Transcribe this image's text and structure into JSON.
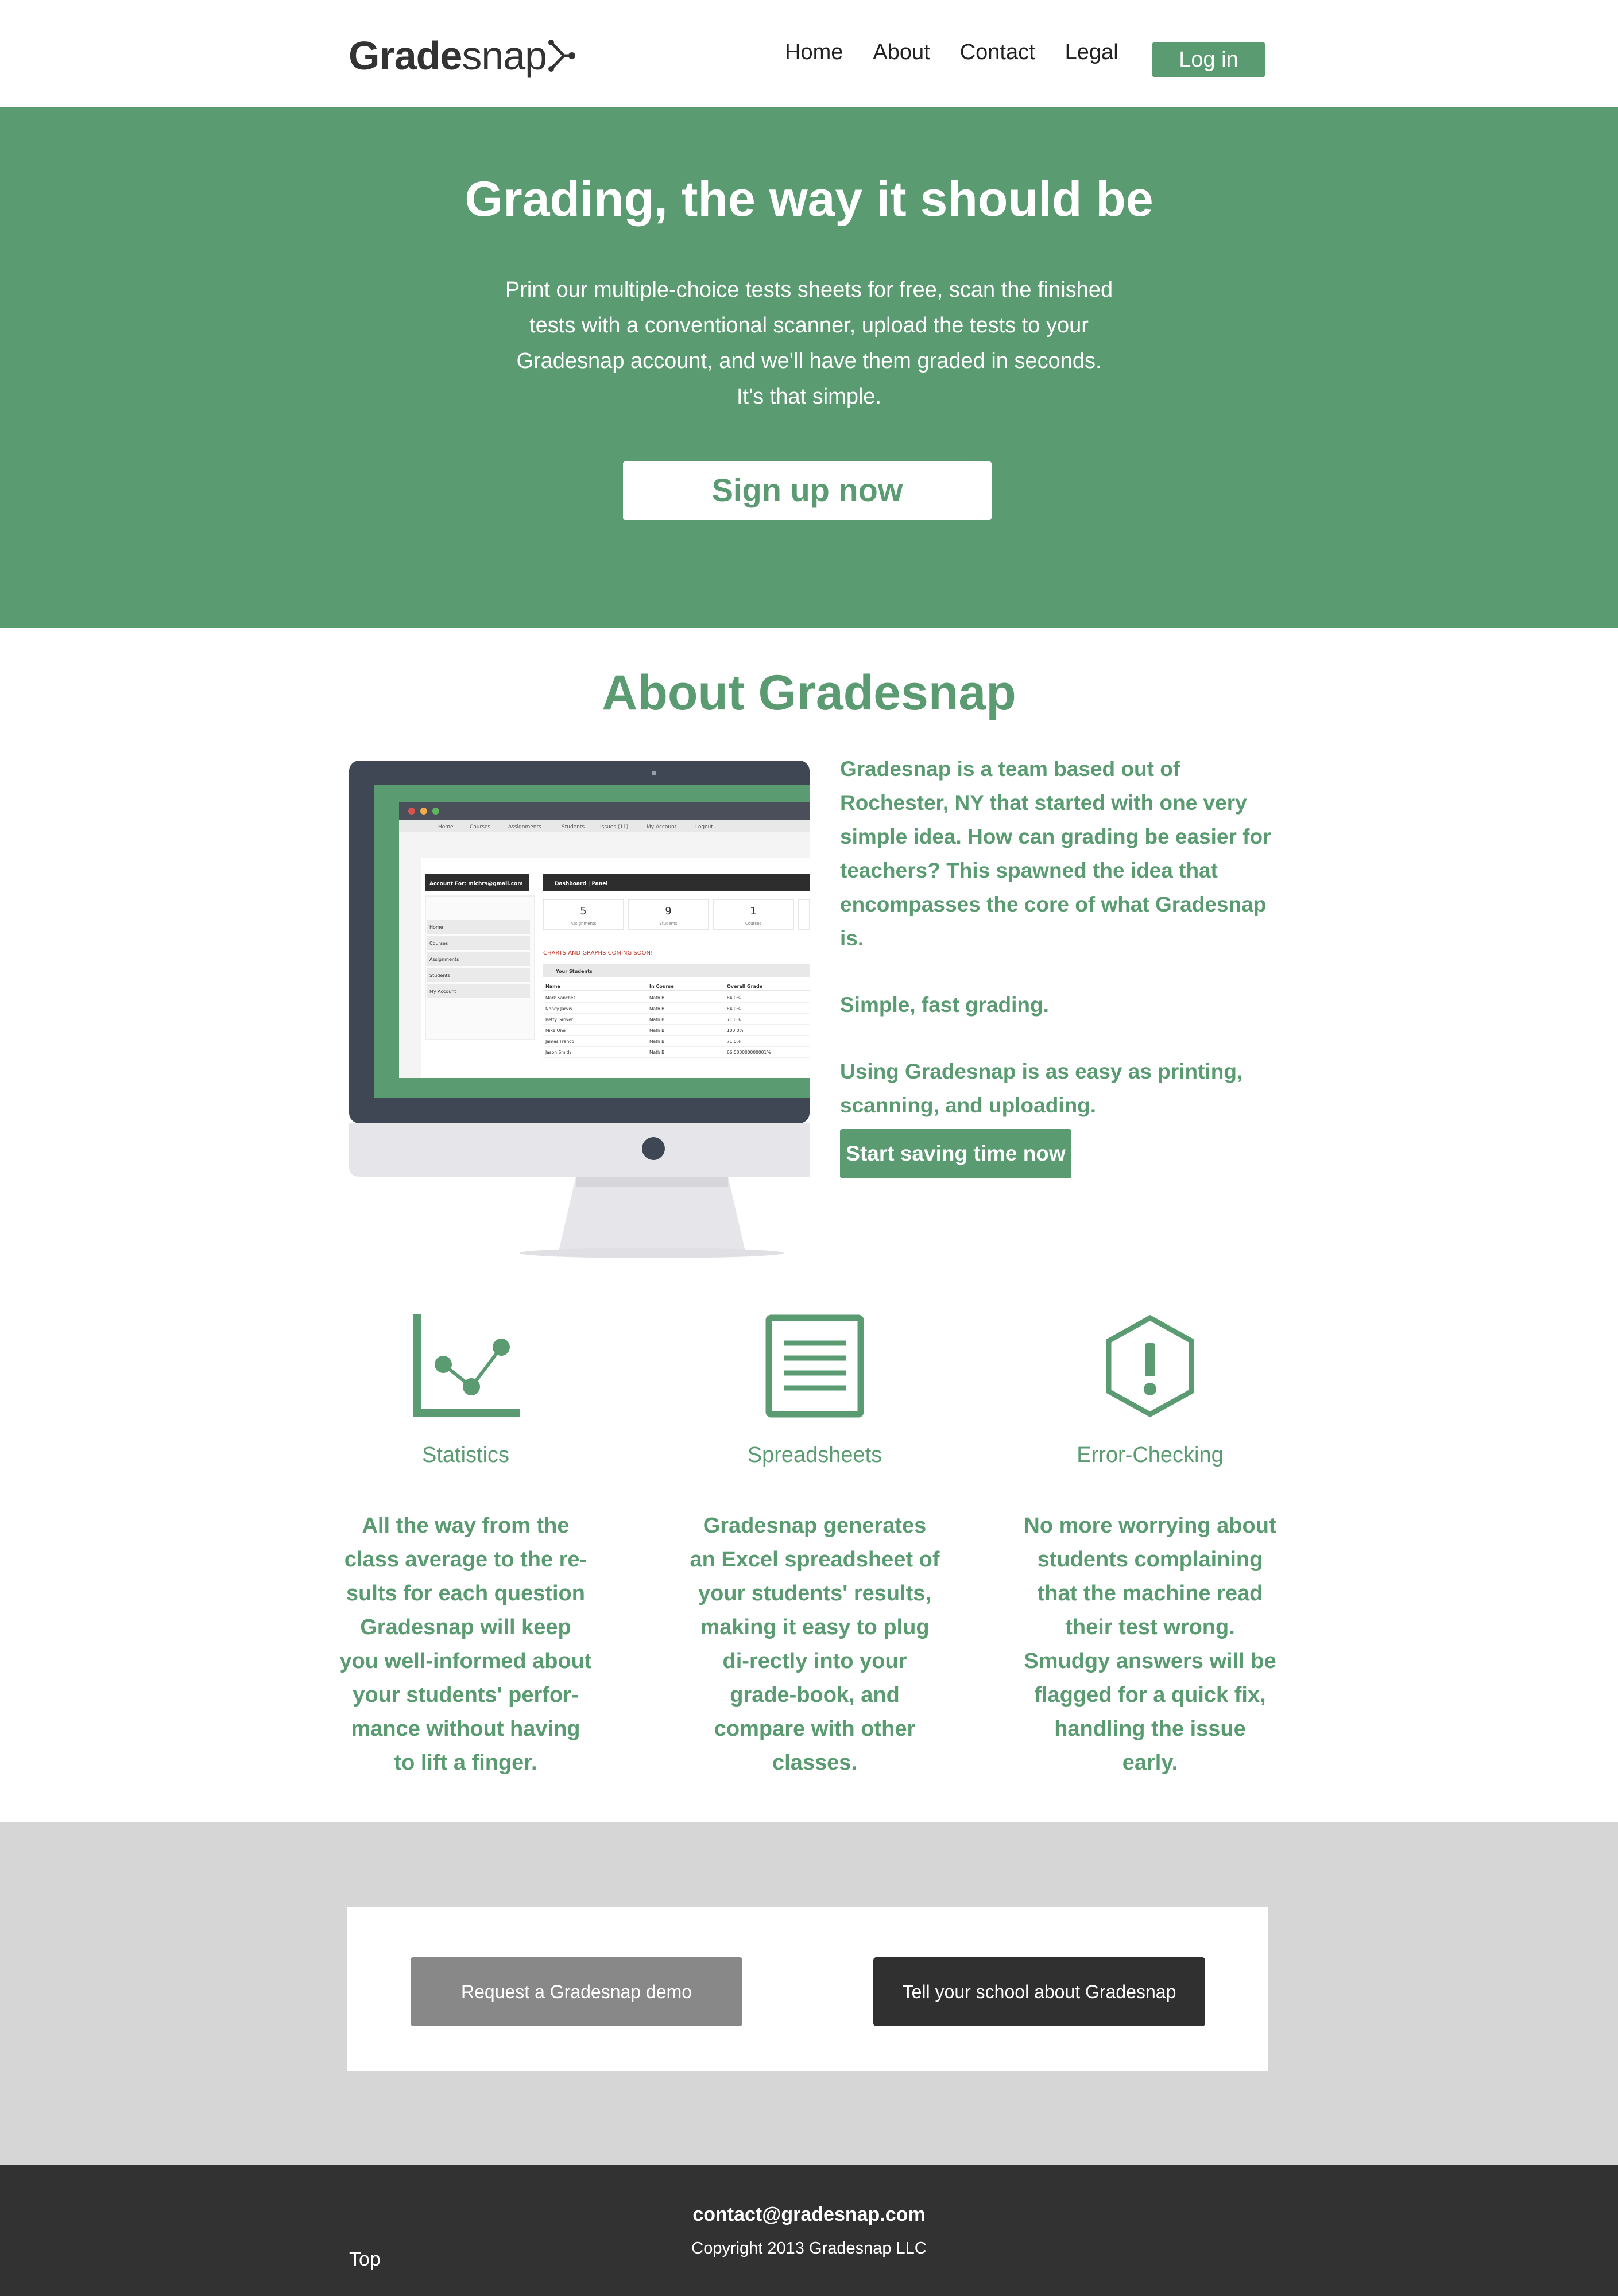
{
  "nav": {
    "logo_bold": "Grade",
    "logo_light": "snap",
    "links": [
      "Home",
      "About",
      "Contact",
      "Legal"
    ],
    "login_label": "Log in"
  },
  "hero": {
    "title": "Grading, the way it should be",
    "text": "Print our multiple-choice tests sheets for free, scan the finished tests with a conventional scanner, upload the tests to your Gradesnap account, and we'll have them graded in seconds. It's that simple.",
    "signup_label": "Sign up now"
  },
  "about": {
    "title": "About Gradesnap",
    "paragraphs": [
      "Gradesnap is a team based out of Rochester, NY that started with one very simple idea. How can grading be easier for teachers? This spawned the idea that encompasses the core of what Gradesnap is.",
      "Simple, fast grading.",
      "Using Gradesnap is as easy as printing, scanning, and uploading."
    ],
    "cta_label": "Start saving time now"
  },
  "screen": {
    "menu": [
      "Home",
      "Courses",
      "Assignments",
      "Students",
      "Issues (11)",
      "My Account",
      "Logout"
    ],
    "account": "Account For: mlchrs@gmail.com",
    "sidebar": [
      "Home",
      "Courses",
      "Assignments",
      "Students",
      "My Account"
    ],
    "panel_title": "Dashboard | Panel",
    "stats": [
      {
        "value": "5",
        "label": "Assignments"
      },
      {
        "value": "9",
        "label": "Students"
      },
      {
        "value": "1",
        "label": "Courses"
      }
    ],
    "notice": "CHARTS AND GRAPHS COMING SOON!",
    "table_title": "Your Students",
    "columns": [
      "Name",
      "In Course",
      "Overall Grade"
    ],
    "rows": [
      [
        "Mark Sanchez",
        "Math B",
        "84.0%"
      ],
      [
        "Nancy Jarvis",
        "Math B",
        "84.0%"
      ],
      [
        "Betty Grover",
        "Math B",
        "71.0%"
      ],
      [
        "Mike One",
        "Math B",
        "100.0%"
      ],
      [
        "James Franco",
        "Math B",
        "71.0%"
      ],
      [
        "Jason Smith",
        "Math B",
        "66.000000000001%"
      ]
    ]
  },
  "features": [
    {
      "icon": "chart-icon",
      "title": "Statistics",
      "desc": "All the way from the class average to the re-sults for each question Gradesnap will keep you well-informed about your students' perfor-mance without having to lift a finger."
    },
    {
      "icon": "spreadsheet-icon",
      "title": "Spreadsheets",
      "desc": "Gradesnap generates an Excel spreadsheet of your students' results, making it easy to plug di-rectly into your grade-book, and compare with other classes."
    },
    {
      "icon": "warning-hexagon-icon",
      "title": "Error-Checking",
      "desc": "No more worrying about students complaining that the machine read their test wrong. Smudgy answers will be flagged for a quick fix, handling the issue early."
    }
  ],
  "cta": {
    "demo_label": "Request a Gradesnap demo",
    "tell_label": "Tell your school about Gradesnap"
  },
  "footer": {
    "top_label": "Top",
    "email": "contact@gradesnap.com",
    "copyright": "Copyright 2013 Gradesnap LLC"
  },
  "colors": {
    "brand_green": "#5a9b71",
    "dark": "#323232",
    "gray_section": "#d6d6d6",
    "demo_button": "#888888"
  }
}
